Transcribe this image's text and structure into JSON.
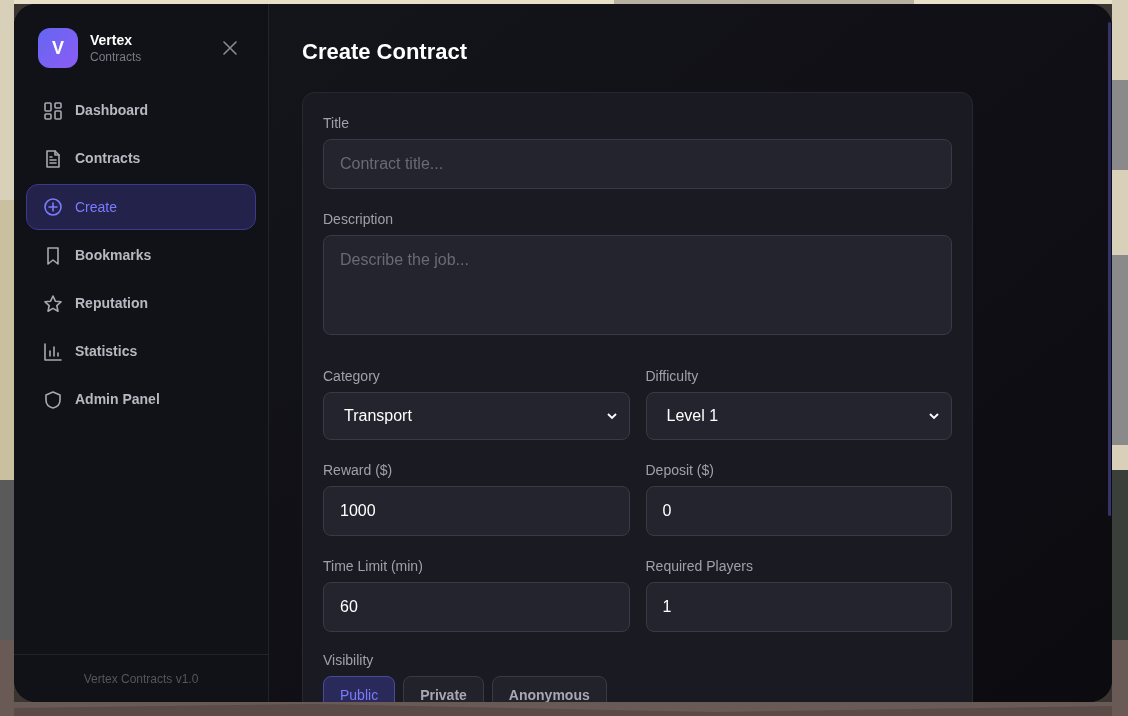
{
  "sidebar": {
    "logo_letter": "V",
    "brand": "Vertex",
    "subtitle": "Contracts",
    "items": [
      {
        "label": "Dashboard",
        "selected": false
      },
      {
        "label": "Contracts",
        "selected": false
      },
      {
        "label": "Create",
        "selected": true
      },
      {
        "label": "Bookmarks",
        "selected": false
      },
      {
        "label": "Reputation",
        "selected": false
      },
      {
        "label": "Statistics",
        "selected": false
      },
      {
        "label": "Admin Panel",
        "selected": false
      }
    ],
    "footer": "Vertex Contracts v1.0"
  },
  "main": {
    "title": "Create Contract",
    "fields": [
      {
        "kind": "text",
        "label": "Title",
        "placeholder": "Contract title..."
      },
      {
        "kind": "textarea",
        "label": "Description",
        "placeholder": "Describe the job..."
      },
      {
        "kind": "select",
        "label": "Category",
        "value": "Transport"
      },
      {
        "kind": "select",
        "label": "Difficulty",
        "value": "Level 1"
      },
      {
        "kind": "number",
        "label": "Reward ($)",
        "value": "1000"
      },
      {
        "kind": "number",
        "label": "Deposit ($)",
        "value": "0"
      },
      {
        "kind": "number",
        "label": "Time Limit (min)",
        "value": "60"
      },
      {
        "kind": "number",
        "label": "Required Players",
        "value": "1"
      }
    ],
    "visibility": {
      "label": "Visibility",
      "options": [
        {
          "label": "Public",
          "selected": true
        },
        {
          "label": "Private",
          "selected": false
        },
        {
          "label": "Anonymous",
          "selected": false
        }
      ]
    }
  }
}
